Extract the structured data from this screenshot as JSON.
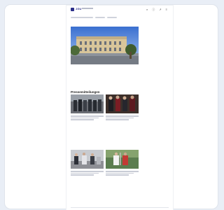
{
  "header": {
    "logo_text": "JGU",
    "icons": [
      "search-icon",
      "info-icon",
      "share-icon",
      "menu-icon"
    ]
  },
  "pills": [],
  "hero": {
    "title": "",
    "subtitle": "",
    "text": "",
    "link": ""
  },
  "section": {
    "title": "Pressemitteilungen"
  },
  "cards": [
    {
      "meta": "",
      "tags": [
        "",
        ""
      ],
      "headline": ""
    },
    {
      "meta": "",
      "tags": [
        "",
        ""
      ],
      "headline": ""
    },
    {
      "meta": "",
      "tags": [
        "",
        ""
      ],
      "headline": ""
    },
    {
      "meta": "",
      "tags": [
        "",
        ""
      ],
      "headline": ""
    }
  ],
  "colors": {
    "brand": "#2c2f8a",
    "background": "#e9eef6"
  }
}
